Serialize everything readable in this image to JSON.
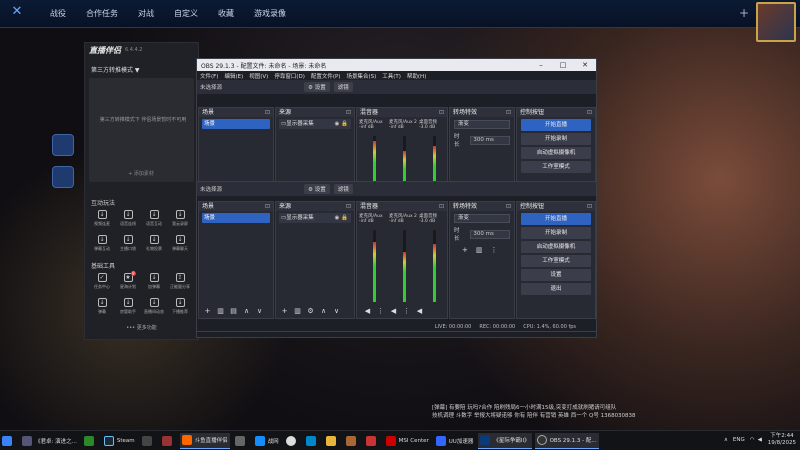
{
  "game": {
    "nav": [
      "战役",
      "合作任务",
      "对战",
      "自定义",
      "收藏",
      "游戏录像"
    ],
    "plus": "+"
  },
  "douyu": {
    "title": "直播伴侣",
    "version": "6.4.4.2",
    "mode": "第三方转推模式 ▼",
    "mode_hint": "第三方转推模式下 伴侣场景暂时不可用",
    "add_scene": "+ 添加素材",
    "interactive_title": "互动玩法",
    "interactive": [
      "视频连麦",
      "语音连线",
      "语音互动",
      "我云录屏",
      "弹幕互动",
      "主播口袋",
      "礼物投票",
      "弹幕聊天"
    ],
    "tools_title": "基础工具",
    "tools": [
      "任务中心",
      "星海计划",
      "加弹幕",
      "正能量分享",
      "弹幕",
      "房管助手",
      "直播间动态",
      "下播推荐"
    ],
    "tools_badge": "9",
    "more": "••• 更多功能"
  },
  "obs1": {
    "title": "OBS 29.1.3 - 配置文件: 未命名 - 场景: 未命名",
    "menu": [
      "文件(F)",
      "编辑(E)",
      "视图(V)",
      "停靠窗口(D)",
      "配置文件(P)",
      "场景集合(S)",
      "工具(T)",
      "帮助(H)"
    ],
    "preview_label": "未选择源",
    "settings_btn": "⚙ 设置",
    "filter_btn": "滤镜",
    "scenes_title": "场景",
    "scene": "场景",
    "sources_title": "来源",
    "source": "显示器采集",
    "mixer_title": "混音器",
    "mix": [
      {
        "name": "麦克风/Aux",
        "db": "-inf dB"
      },
      {
        "name": "麦克风/Aux 2",
        "db": "-inf dB"
      },
      {
        "name": "桌面音频",
        "db": "-3.0 dB"
      }
    ],
    "trans_title": "转场特效",
    "trans": "渐变",
    "dur_label": "时长",
    "dur": "300 ms",
    "ctrl_title": "控制按钮",
    "ctrl": [
      "开始直播",
      "开始录制",
      "自动虚拟摄像机",
      "工作室模式"
    ]
  },
  "obs2": {
    "preview_label": "未选择源",
    "settings_btn": "⚙ 设置",
    "filter_btn": "滤镜",
    "scenes_title": "场景",
    "scene": "场景",
    "sources_title": "来源",
    "source": "显示器采集",
    "mixer_title": "混音器",
    "mix": [
      {
        "name": "麦克风/Aux",
        "db": "-inf dB"
      },
      {
        "name": "麦克风/Aux 2",
        "db": "-inf dB"
      },
      {
        "name": "桌面音频",
        "db": "-3.0 dB"
      }
    ],
    "trans_title": "转场特效",
    "trans": "渐变",
    "dur_label": "时长",
    "dur": "300 ms",
    "ctrl_title": "控制按钮",
    "ctrl": [
      "开始直播",
      "开始录制",
      "启动虚拟摄像机",
      "工作室模式",
      "设置",
      "退出"
    ],
    "status": {
      "live": "LIVE: 00:00:00",
      "rec": "REC: 00:00:00",
      "cpu": "CPU: 1.4%, 60.00 fps"
    }
  },
  "chat": [
    "[弹幕] 有要陪 玩吗?合作 陪刷残局6一小时满15级,突变打成就刷猪请可组队",
    "技机调理 斗数字 举报大将疑诺够 你有 陪伴 有营销 英雄 西一个 Q号 1368030838"
  ],
  "taskbar": {
    "items": [
      "《君卓: 演进之...",
      "",
      "Steam",
      "",
      "",
      "斗鱼直播伴侣",
      "",
      "战网",
      "",
      "",
      "",
      "",
      "",
      "MSI Center",
      "UU加速器",
      "《星际争霸II》",
      "OBS 29.1.3 - 配..."
    ],
    "lang": "ENG",
    "time": "下午2:44",
    "date": "19/8/2025"
  }
}
